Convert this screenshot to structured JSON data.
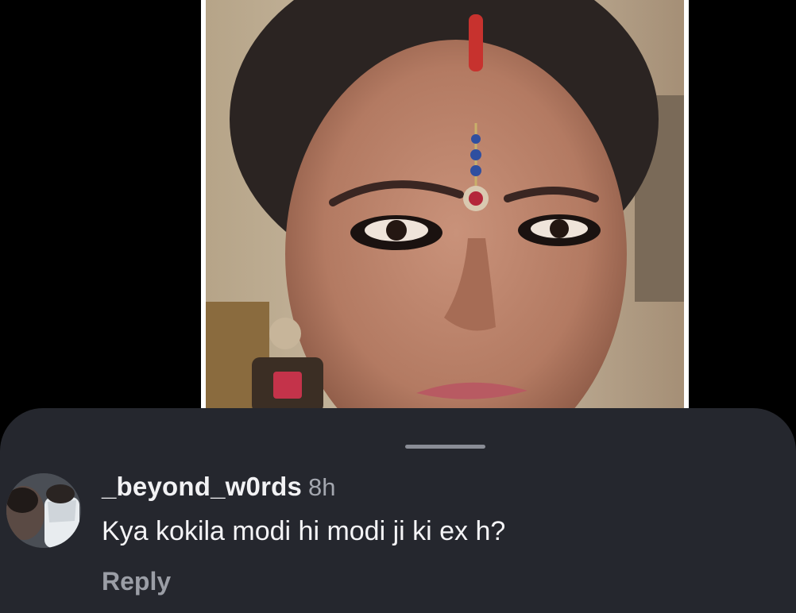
{
  "post": {
    "image_icon": "post-photo",
    "image_description": ""
  },
  "comment_sheet": {
    "comment": {
      "avatar_icon": "user-avatar",
      "username": "_beyond_w0rds",
      "timestamp": "8h",
      "text": "Kya kokila modi hi modi ji ki ex h?",
      "reply_label": "Reply"
    }
  },
  "colors": {
    "background": "#000000",
    "sheet": "#25272e",
    "grabber": "#8a8d96",
    "username": "#f2f2f4",
    "muted_text": "#a4a7af"
  }
}
